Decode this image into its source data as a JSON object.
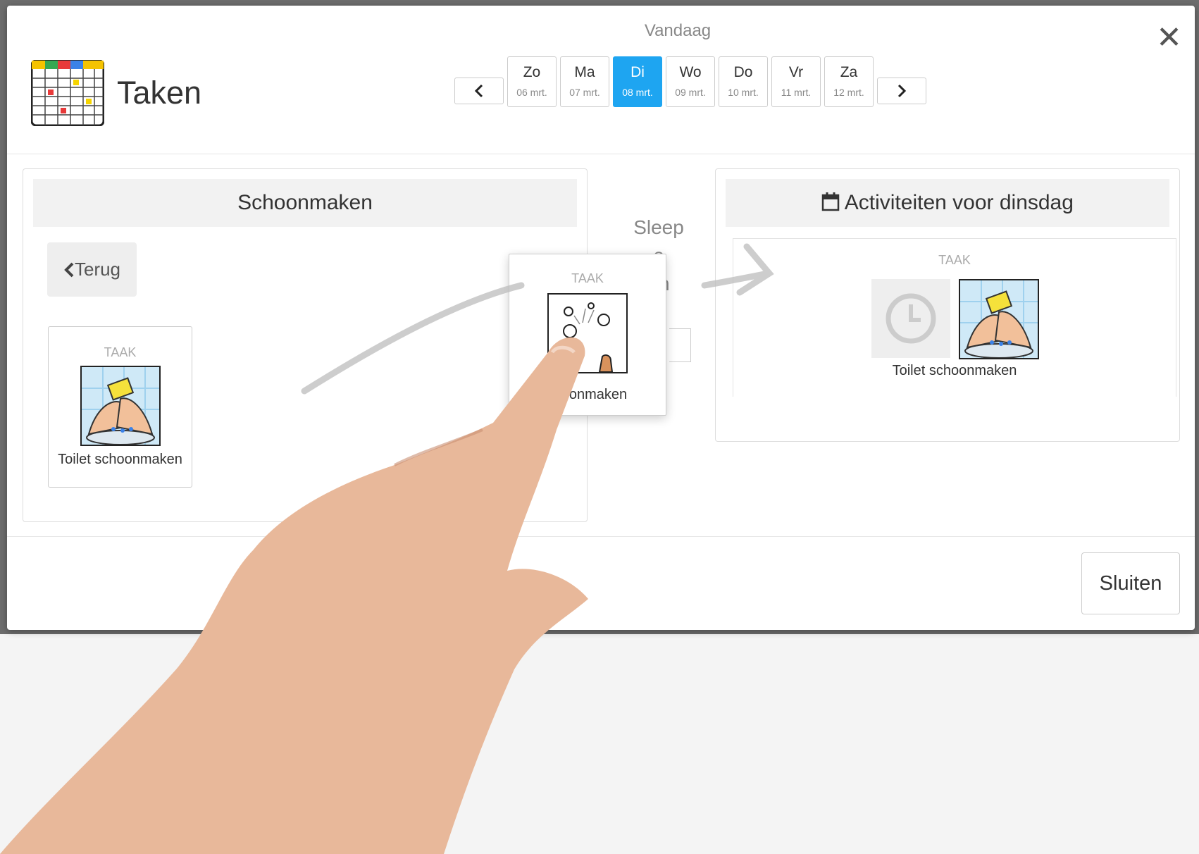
{
  "modal": {
    "title": "Taken",
    "today_label": "Vandaag",
    "days": [
      {
        "name": "Zo",
        "date": "06 mrt."
      },
      {
        "name": "Ma",
        "date": "07 mrt."
      },
      {
        "name": "Di",
        "date": "08 mrt."
      },
      {
        "name": "Wo",
        "date": "09 mrt."
      },
      {
        "name": "Do",
        "date": "10 mrt."
      },
      {
        "name": "Vr",
        "date": "11 mrt."
      },
      {
        "name": "Za",
        "date": "12 mrt."
      }
    ],
    "active_day": "Di",
    "close_label": "Sluiten"
  },
  "left_panel": {
    "title": "Schoonmaken",
    "back_label": "Terug",
    "cards": [
      {
        "kind": "TAAK",
        "name": "Toilet schoonmaken"
      }
    ]
  },
  "center_hint": {
    "line1": "Sleep",
    "line2": "e",
    "line3": "en"
  },
  "dragged_card": {
    "kind": "TAAK",
    "name_visible": "Ke onmaken"
  },
  "right_panel": {
    "title": "Activiteiten voor dinsdag",
    "cards": [
      {
        "kind": "TAAK",
        "name": "Toilet schoonmaken"
      }
    ]
  },
  "colors": {
    "accent": "#1ea5f1"
  }
}
